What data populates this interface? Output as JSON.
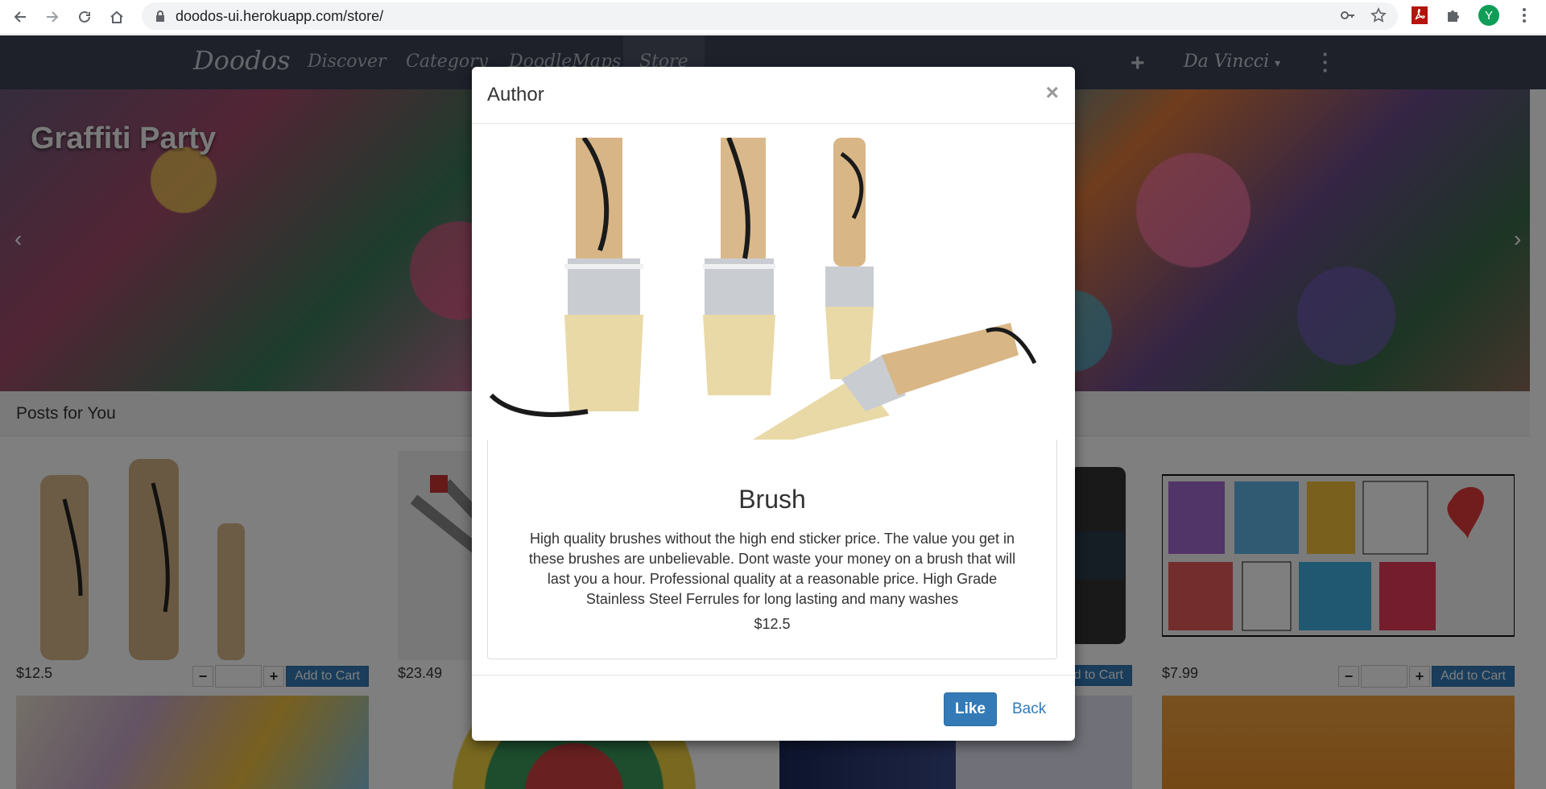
{
  "browser": {
    "url": "doodos-ui.herokuapp.com/store/",
    "avatar_letter": "Y"
  },
  "navbar": {
    "brand": "Doodos",
    "links": [
      "Discover",
      "Category",
      "DoodleMaps",
      "Store"
    ],
    "user": "Da Vincci"
  },
  "banner": {
    "title": "Graffiti Party"
  },
  "posts": {
    "heading": "Posts for You",
    "add_to_cart_label": "Add to Cart",
    "prices": [
      "$12.5",
      "$23.49",
      "$7.99"
    ]
  },
  "modal": {
    "title": "Author",
    "close": "×",
    "product_name": "Brush",
    "description": "High quality brushes without the high end sticker price. The value you get in these brushes are unbelievable. Dont waste your money on a brush that will last you a hour. Professional quality at a reasonable price. High Grade Stainless Steel Ferrules for long lasting and many washes",
    "price": "$12.5",
    "like_label": "Like",
    "back_label": "Back"
  },
  "colors": {
    "navbar": "#3d4354",
    "primary": "#337ab7"
  }
}
